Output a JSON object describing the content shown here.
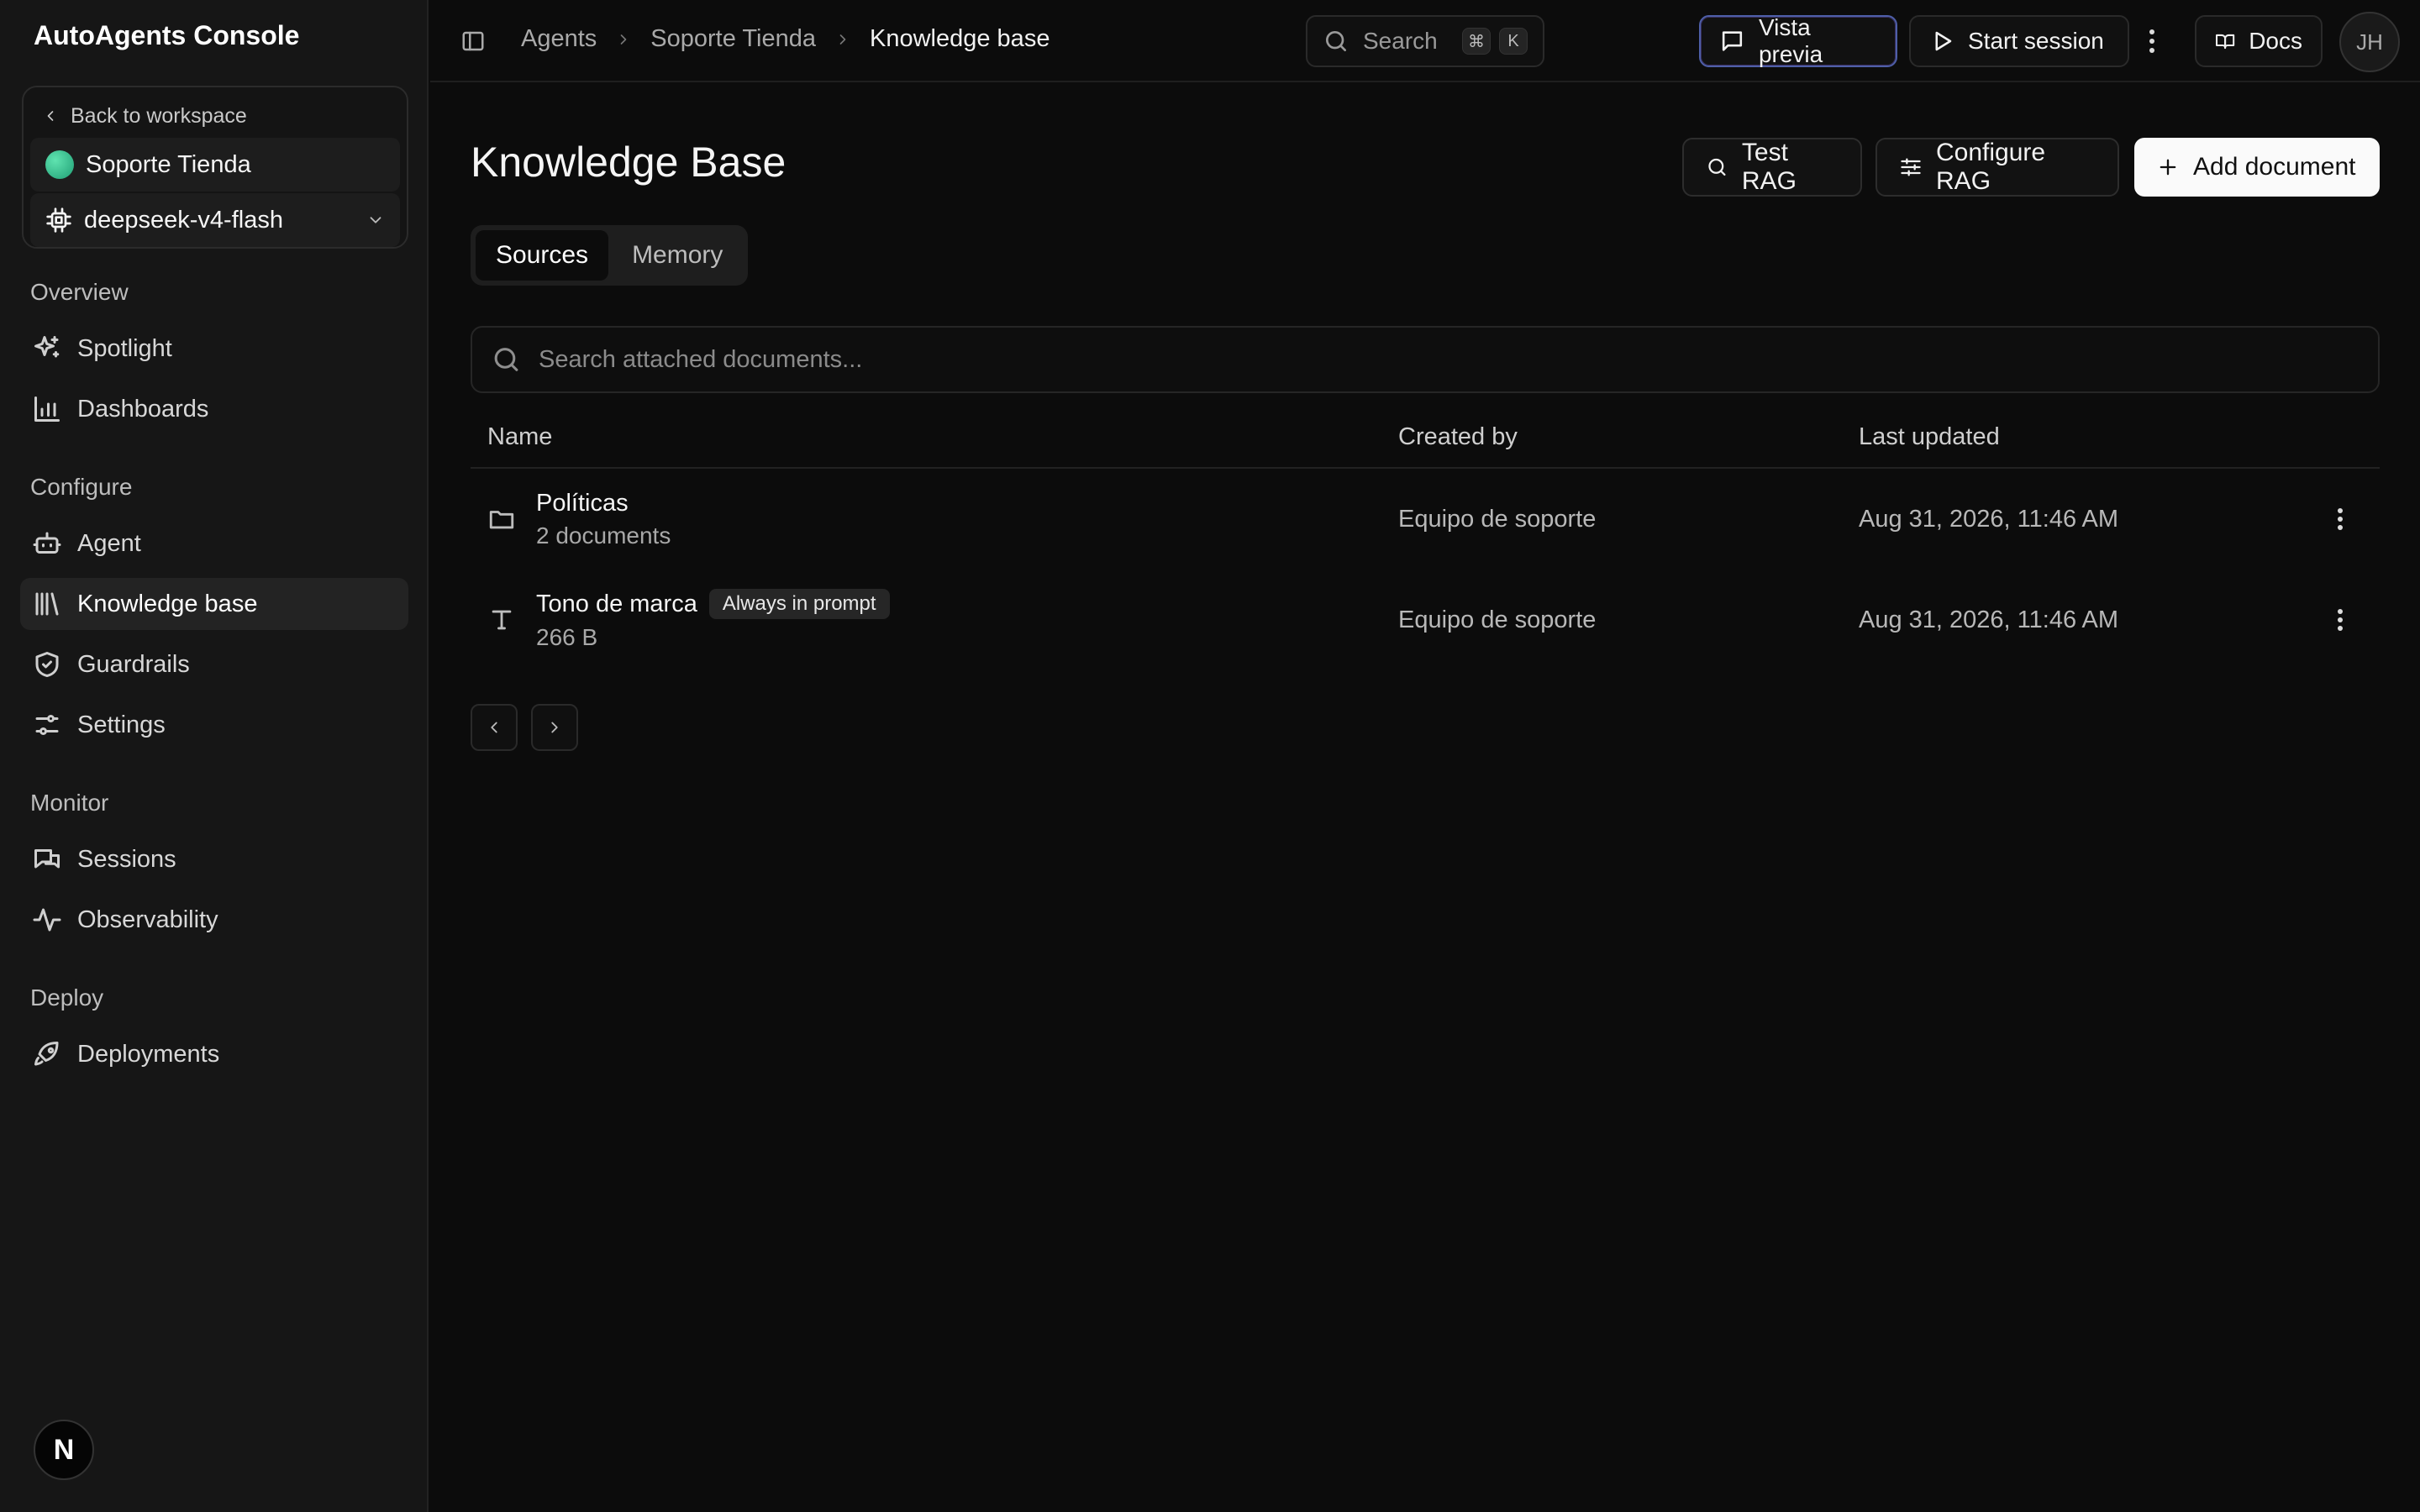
{
  "app": {
    "title": "AutoAgents Console"
  },
  "workspace": {
    "back_label": "Back to workspace",
    "agent_name": "Soporte Tienda",
    "model": "deepseek-v4-flash"
  },
  "nav": {
    "sections": [
      {
        "label": "Overview",
        "items": [
          {
            "label": "Spotlight",
            "icon": "sparkles-icon"
          },
          {
            "label": "Dashboards",
            "icon": "bar-chart-icon"
          }
        ]
      },
      {
        "label": "Configure",
        "items": [
          {
            "label": "Agent",
            "icon": "bot-icon"
          },
          {
            "label": "Knowledge base",
            "icon": "library-icon",
            "active": true
          },
          {
            "label": "Guardrails",
            "icon": "shield-icon"
          },
          {
            "label": "Settings",
            "icon": "sliders-icon"
          }
        ]
      },
      {
        "label": "Monitor",
        "items": [
          {
            "label": "Sessions",
            "icon": "messages-icon"
          },
          {
            "label": "Observability",
            "icon": "activity-icon"
          }
        ]
      },
      {
        "label": "Deploy",
        "items": [
          {
            "label": "Deployments",
            "icon": "rocket-icon"
          }
        ]
      }
    ],
    "badge": "N"
  },
  "topbar": {
    "breadcrumb": [
      "Agents",
      "Soporte Tienda",
      "Knowledge base"
    ],
    "search_label": "Search",
    "search_keys": [
      "⌘",
      "K"
    ],
    "preview_label": "Vista previa",
    "start_label": "Start session",
    "docs_label": "Docs",
    "avatar_initials": "JH"
  },
  "main": {
    "title": "Knowledge Base",
    "actions": {
      "test_rag": "Test RAG",
      "configure_rag": "Configure RAG",
      "add_document": "Add document"
    },
    "tabs": [
      {
        "label": "Sources",
        "active": true
      },
      {
        "label": "Memory",
        "active": false
      }
    ],
    "search_placeholder": "Search attached documents...",
    "table": {
      "columns": [
        "Name",
        "Created by",
        "Last updated"
      ],
      "rows": [
        {
          "name": "Políticas",
          "sub": "2 documents",
          "icon": "folder-icon",
          "tag": "",
          "created_by": "Equipo de soporte",
          "updated": "Aug 31, 2026, 11:46 AM"
        },
        {
          "name": "Tono de marca",
          "sub": "266 B",
          "icon": "text-icon",
          "tag": "Always in prompt",
          "created_by": "Equipo de soporte",
          "updated": "Aug 31, 2026, 11:46 AM"
        }
      ]
    }
  },
  "colors": {
    "background": "#0c0c0c",
    "sidebar": "#161616",
    "primary_button": "#fafafa",
    "accent_status": "#2fbf8a"
  }
}
